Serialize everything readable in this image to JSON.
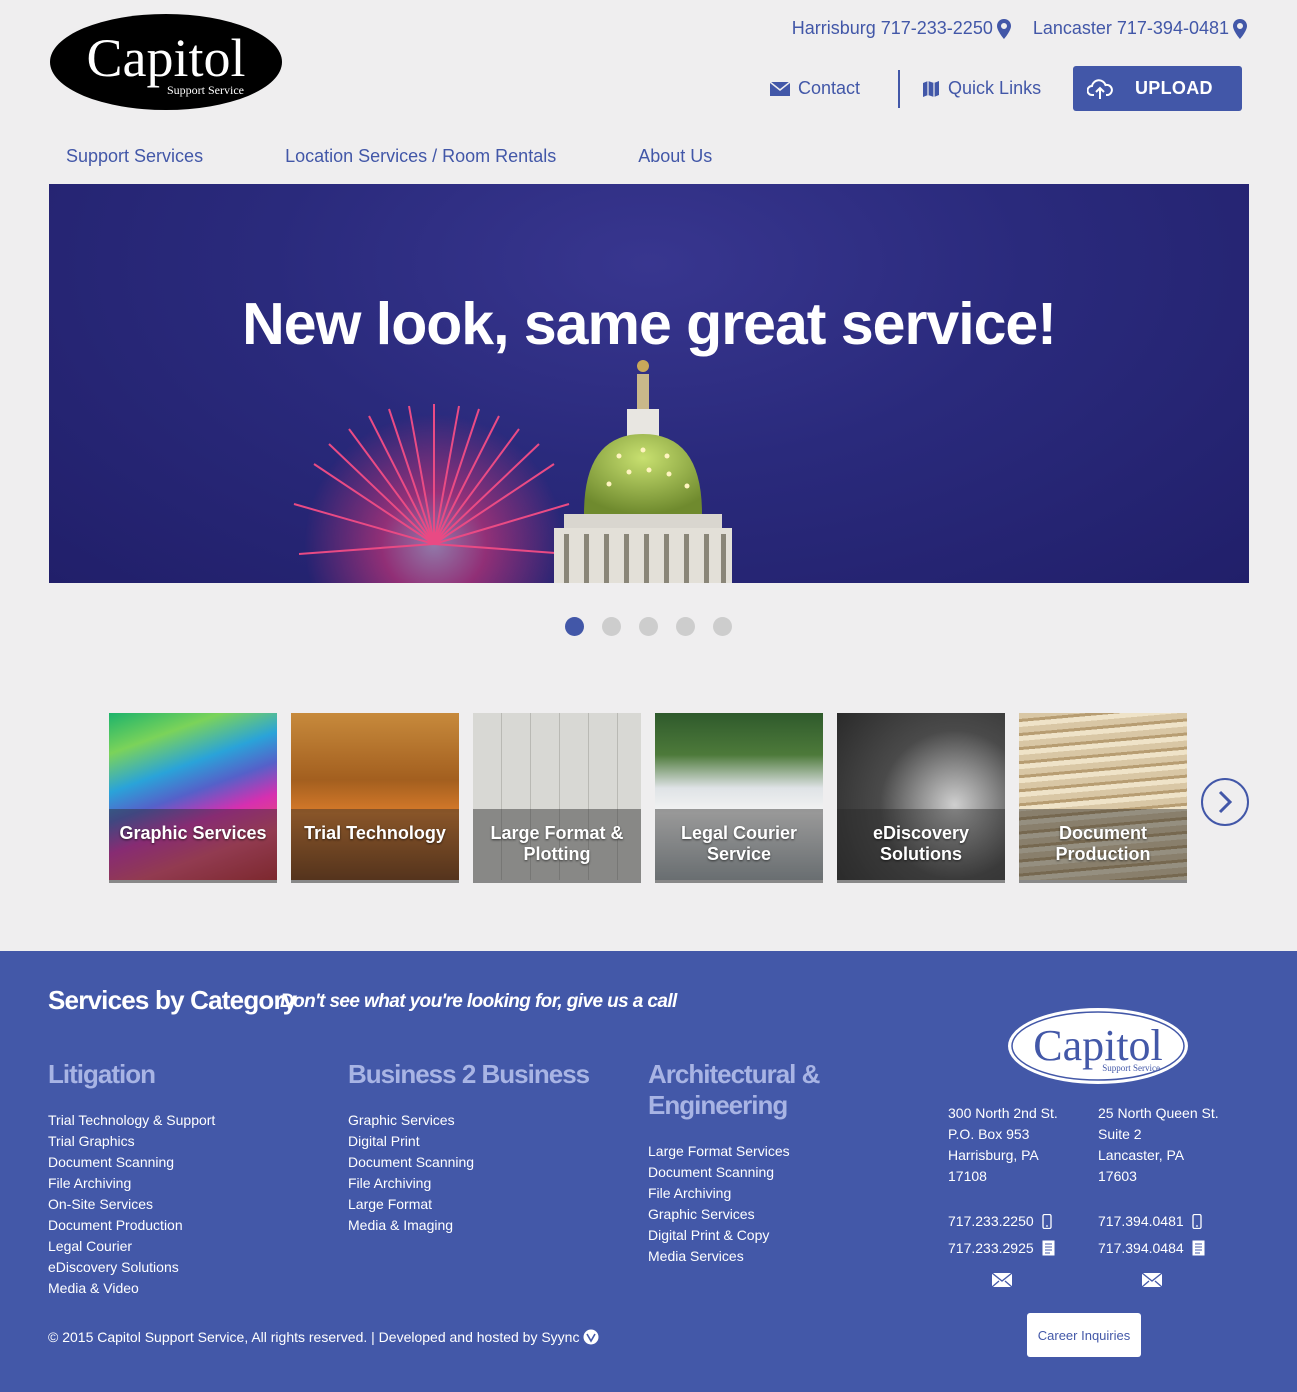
{
  "header": {
    "logo_text": "Capitol",
    "logo_sub": "Support Service",
    "phones": [
      {
        "label": "Harrisburg 717-233-2250"
      },
      {
        "label": "Lancaster 717-394-0481"
      }
    ],
    "contact_label": "Contact",
    "quick_links_label": "Quick Links",
    "upload_label": "UPLOAD"
  },
  "nav": {
    "items": [
      "Support Services",
      "Location Services / Room Rentals",
      "About Us"
    ]
  },
  "hero": {
    "title": "New look, same great service!",
    "slides_count": 5,
    "active_slide": 1
  },
  "tiles": [
    {
      "label": "Graphic Services"
    },
    {
      "label": "Trial Technology"
    },
    {
      "label": "Large Format & Plotting"
    },
    {
      "label": "Legal Courier Service"
    },
    {
      "label": "eDiscovery Solutions"
    },
    {
      "label": "Document Production"
    }
  ],
  "footer": {
    "title": "Services by Category",
    "tagline": "Don't see what you're looking for, give us a call",
    "categories": [
      {
        "title": "Litigation",
        "items": [
          "Trial Technology & Support",
          "Trial Graphics",
          "Document Scanning",
          "File Archiving",
          "On-Site Services",
          "Document Production",
          "Legal Courier",
          "eDiscovery Solutions",
          "Media & Video"
        ]
      },
      {
        "title": "Business 2 Business",
        "items": [
          "Graphic Services",
          "Digital Print",
          "Document Scanning",
          "File Archiving",
          "Large Format",
          "Media & Imaging"
        ]
      },
      {
        "title": "Architectural & Engineering",
        "items": [
          "Large Format Services",
          "Document Scanning",
          "File Archiving",
          "Graphic Services",
          "Digital Print & Copy",
          "Media Services"
        ]
      }
    ],
    "logo_text": "Capitol",
    "logo_sub": "Support Service",
    "harrisburg": {
      "address": [
        "300 North 2nd St.",
        "P.O. Box 953",
        "Harrisburg, PA",
        "17108"
      ],
      "phone": "717.233.2250",
      "fax": "717.233.2925"
    },
    "lancaster": {
      "address": [
        "25 North Queen St.",
        "Suite 2",
        "Lancaster, PA",
        "17603"
      ],
      "phone": "717.394.0481",
      "fax": "717.394.0484"
    },
    "career_label": "Career Inquiries",
    "copyright": "© 2015 Capitol Support Service, All rights reserved. | Developed and hosted by Syync"
  }
}
